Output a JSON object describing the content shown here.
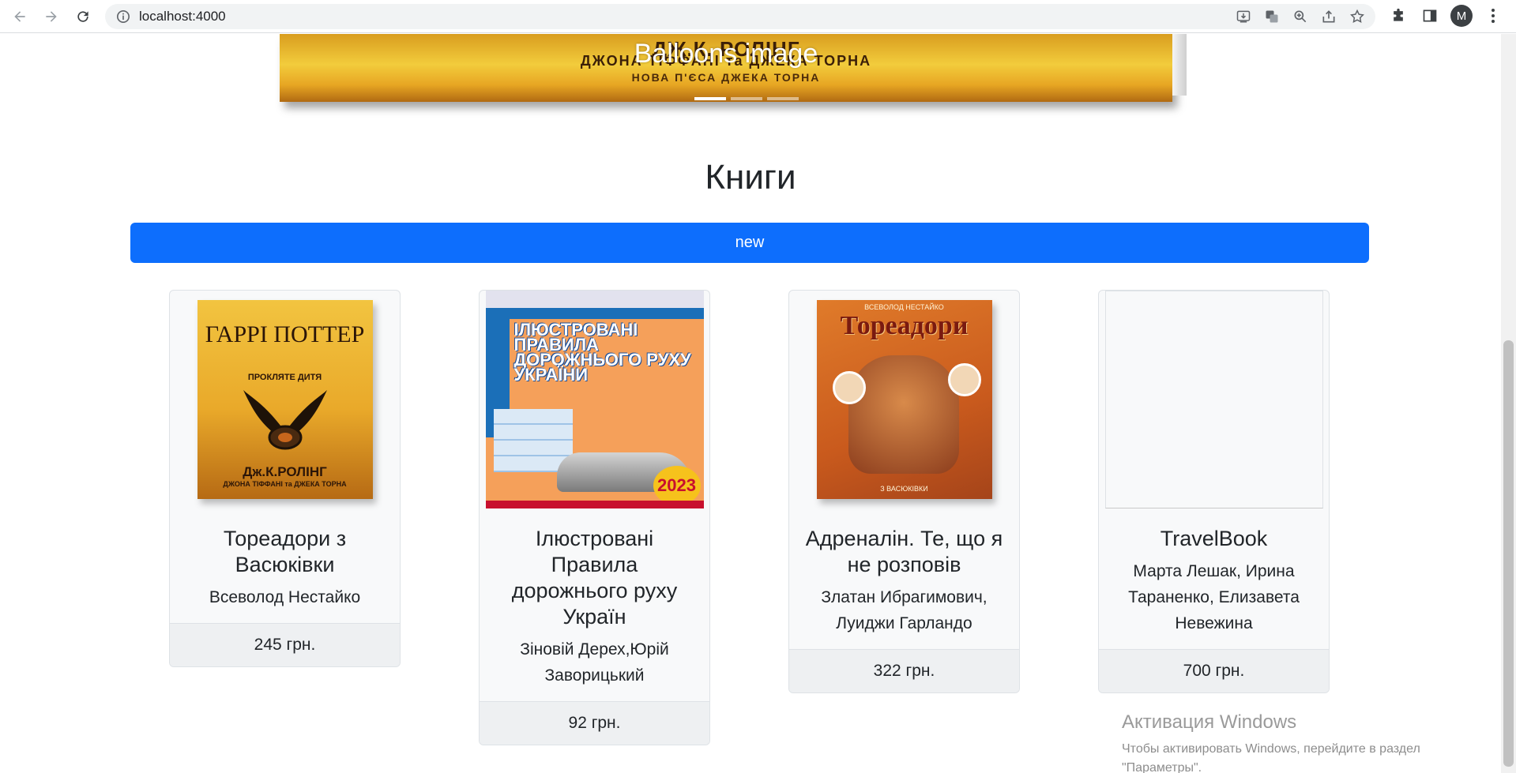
{
  "browser": {
    "url": "localhost:4000",
    "profile_initial": "M"
  },
  "carousel": {
    "caption": "Balloons image",
    "book_lines": [
      "ДЖ.К. РОЛІНГ",
      "ДЖОНА ТІФФАНІ та ДЖЕКА ТОРНА",
      "НОВА П'ЄСА ДЖЕКА ТОРНА"
    ],
    "active_slide": 1,
    "slide_count": 3
  },
  "page": {
    "title": "Книги",
    "new_button_label": "new"
  },
  "books": [
    {
      "title": "Тореадори з Васюківки",
      "author": "Всеволод Нестайко",
      "price": "245 грн.",
      "cover": {
        "kind": "harry-potter",
        "lines": [
          "ГАРРІ ПОТТЕР",
          "ПРОКЛЯТЕ ДИТЯ",
          "Дж.К.РОЛІНГ",
          "ДЖОНА ТІФФАНІ та ДЖЕКА ТОРНА"
        ]
      }
    },
    {
      "title": "Ілюстровані Правила дорожнього руху Україн",
      "author": "Зіновій Дерех,Юрій Заворицький",
      "price": "92 грн.",
      "cover": {
        "kind": "pdr",
        "lines": [
          "ІЛЮСТРОВАНІ ПРАВИЛА ДОРОЖНЬОГО РУХУ УКРАЇНИ",
          "2023"
        ]
      }
    },
    {
      "title": "Адреналін. Те, що я не розповів",
      "author": "Златан Ибрагимович, Луиджи Гарландо",
      "price": "322 грн.",
      "cover": {
        "kind": "toreadory",
        "lines": [
          "ВСЕВОЛОД НЕСТАЙКО",
          "Тореадори",
          "З ВАСЮКІВКИ"
        ]
      }
    },
    {
      "title": "TravelBook",
      "author": "Марта Лешак, Ирина Тараненко, Елизавета Невежина",
      "price": "700 грн.",
      "cover": {
        "kind": "empty"
      }
    }
  ],
  "windows_activation": {
    "title": "Активация Windows",
    "message": "Чтобы активировать Windows, перейдите в раздел \"Параметры\"."
  },
  "colors": {
    "primary": "#0d6efd",
    "card_bg": "#f8f9fa",
    "card_border": "#dee2e6"
  }
}
